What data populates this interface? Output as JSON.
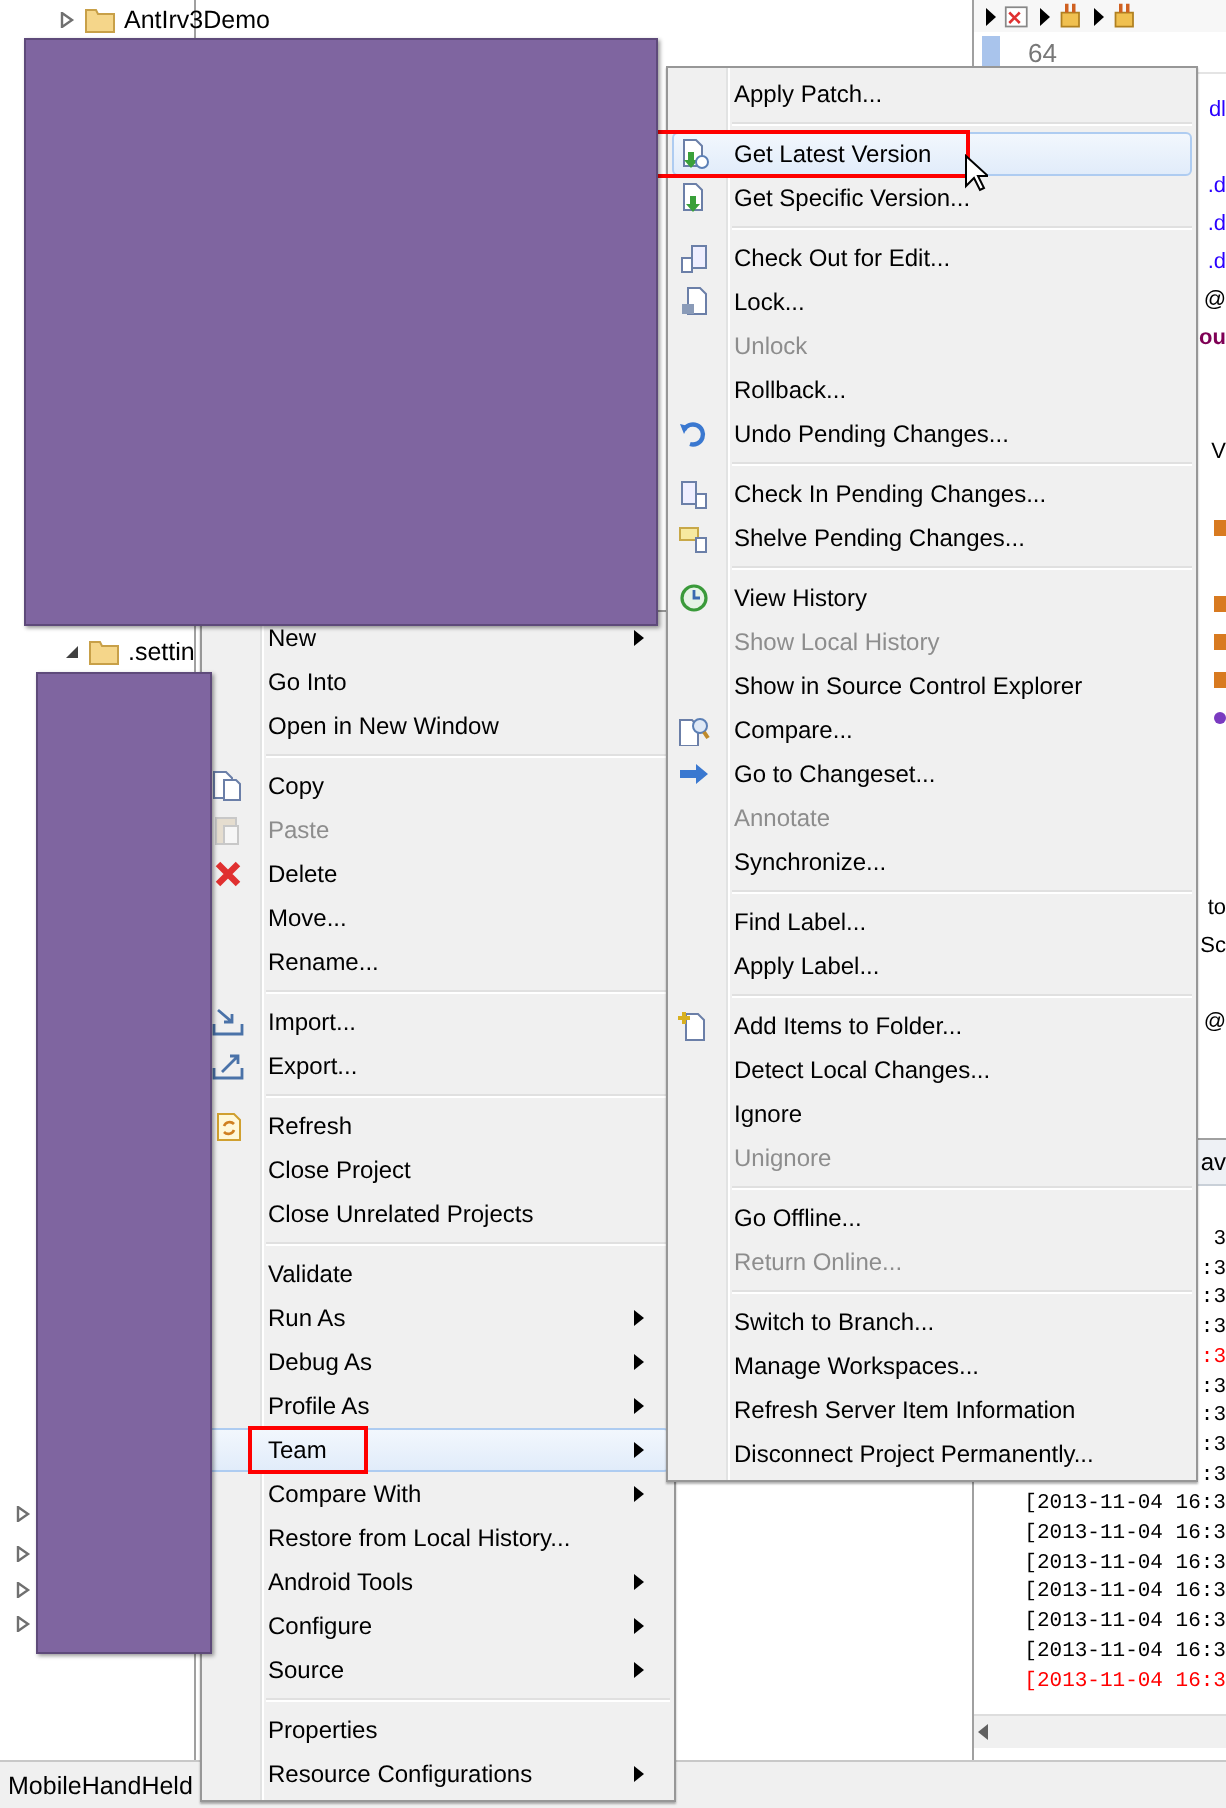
{
  "tree": [
    {
      "label": "AntIrv3Demo",
      "expanded": false
    },
    {
      "label": ".settin",
      "expanded": true
    },
    {
      "expanded": false
    },
    {
      "expanded": false
    },
    {
      "expanded": false
    },
    {
      "expanded": false
    }
  ],
  "editor": {
    "line_number": "64",
    "lines": [
      {
        "kind": "link",
        "text": "dl"
      },
      {
        "kind": "blank"
      },
      {
        "kind": "link",
        "text": ".d"
      },
      {
        "kind": "link",
        "text": ".d"
      },
      {
        "kind": "link",
        "text": ".d"
      },
      {
        "kind": "plain",
        "text": "@"
      },
      {
        "kind": "keyword",
        "text": "ou"
      },
      {
        "kind": "blank"
      },
      {
        "kind": "blank"
      },
      {
        "kind": "plain",
        "text": "V"
      },
      {
        "kind": "blank"
      },
      {
        "kind": "marker"
      },
      {
        "kind": "blank"
      },
      {
        "kind": "marker"
      },
      {
        "kind": "marker"
      },
      {
        "kind": "marker"
      },
      {
        "kind": "dot"
      },
      {
        "kind": "blank"
      },
      {
        "kind": "blank"
      },
      {
        "kind": "blank"
      },
      {
        "kind": "blank"
      },
      {
        "kind": "plain",
        "text": "to"
      },
      {
        "kind": "plain",
        "text": "Sc"
      },
      {
        "kind": "blank"
      },
      {
        "kind": "plain",
        "text": "@"
      }
    ]
  },
  "console": {
    "tab": "av",
    "lines": [
      {
        "text": "3",
        "error": false
      },
      {
        "text": ":3",
        "error": false
      },
      {
        "text": ":3",
        "error": false
      },
      {
        "text": ":3",
        "error": false
      },
      {
        "text": ":3",
        "error": true
      },
      {
        "text": ":3",
        "error": false
      },
      {
        "text": ":3",
        "error": false
      },
      {
        "text": ":3",
        "error": false
      },
      {
        "text": ":3",
        "error": false
      },
      {
        "text": "[2013-11-04 16:3",
        "error": false
      },
      {
        "text": "[2013-11-04 16:3",
        "error": false
      },
      {
        "text": "[2013-11-04 16:3",
        "error": false
      },
      {
        "text": "[2013-11-04 16:3",
        "error": false
      },
      {
        "text": "[2013-11-04 16:3",
        "error": false
      },
      {
        "text": "[2013-11-04 16:3",
        "error": false
      },
      {
        "text": "[2013-11-04 16:3",
        "error": true
      }
    ]
  },
  "status_bar": "MobileHandHeld",
  "redacted_areas": [
    {
      "kind": "block"
    },
    {
      "kind": "block"
    }
  ],
  "context_menu": {
    "groups": [
      [
        {
          "label": "New",
          "submenu": true,
          "disabled": false,
          "highlighted": false,
          "boxed": false
        },
        {
          "label": "Go Into",
          "submenu": false,
          "disabled": false,
          "highlighted": false,
          "boxed": false
        },
        {
          "label": "Open in New Window",
          "submenu": false,
          "disabled": false,
          "highlighted": false,
          "boxed": false
        }
      ],
      [
        {
          "label": "Copy",
          "submenu": false,
          "disabled": false,
          "highlighted": false,
          "boxed": false
        },
        {
          "label": "Paste",
          "submenu": false,
          "disabled": true,
          "highlighted": false,
          "boxed": false
        },
        {
          "label": "Delete",
          "submenu": false,
          "disabled": false,
          "highlighted": false,
          "boxed": false
        },
        {
          "label": "Move...",
          "submenu": false,
          "disabled": false,
          "highlighted": false,
          "boxed": false
        },
        {
          "label": "Rename...",
          "submenu": false,
          "disabled": false,
          "highlighted": false,
          "boxed": false
        }
      ],
      [
        {
          "label": "Import...",
          "submenu": false,
          "disabled": false,
          "highlighted": false,
          "boxed": false
        },
        {
          "label": "Export...",
          "submenu": false,
          "disabled": false,
          "highlighted": false,
          "boxed": false
        }
      ],
      [
        {
          "label": "Refresh",
          "submenu": false,
          "disabled": false,
          "highlighted": false,
          "boxed": false
        },
        {
          "label": "Close Project",
          "submenu": false,
          "disabled": false,
          "highlighted": false,
          "boxed": false
        },
        {
          "label": "Close Unrelated Projects",
          "submenu": false,
          "disabled": false,
          "highlighted": false,
          "boxed": false
        }
      ],
      [
        {
          "label": "Validate",
          "submenu": false,
          "disabled": false,
          "highlighted": false,
          "boxed": false
        },
        {
          "label": "Run As",
          "submenu": true,
          "disabled": false,
          "highlighted": false,
          "boxed": false
        },
        {
          "label": "Debug As",
          "submenu": true,
          "disabled": false,
          "highlighted": false,
          "boxed": false
        },
        {
          "label": "Profile As",
          "submenu": true,
          "disabled": false,
          "highlighted": false,
          "boxed": false
        },
        {
          "label": "Team",
          "submenu": true,
          "disabled": false,
          "highlighted": true,
          "boxed": true
        },
        {
          "label": "Compare With",
          "submenu": true,
          "disabled": false,
          "highlighted": false,
          "boxed": false
        },
        {
          "label": "Restore from Local History...",
          "submenu": false,
          "disabled": false,
          "highlighted": false,
          "boxed": false
        },
        {
          "label": "Android Tools",
          "submenu": true,
          "disabled": false,
          "highlighted": false,
          "boxed": false
        },
        {
          "label": "Configure",
          "submenu": true,
          "disabled": false,
          "highlighted": false,
          "boxed": false
        },
        {
          "label": "Source",
          "submenu": true,
          "disabled": false,
          "highlighted": false,
          "boxed": false
        }
      ],
      [
        {
          "label": "Properties",
          "submenu": false,
          "disabled": false,
          "highlighted": false,
          "boxed": false
        },
        {
          "label": "Resource Configurations",
          "submenu": true,
          "disabled": false,
          "highlighted": false,
          "boxed": false
        }
      ]
    ]
  },
  "team_submenu": {
    "groups": [
      [
        {
          "label": "Apply Patch...",
          "disabled": false,
          "highlighted": false,
          "boxed": false
        }
      ],
      [
        {
          "label": "Get Latest Version",
          "disabled": false,
          "highlighted": true,
          "boxed": true
        },
        {
          "label": "Get Specific Version...",
          "disabled": false,
          "highlighted": false,
          "boxed": false
        }
      ],
      [
        {
          "label": "Check Out for Edit...",
          "disabled": false,
          "highlighted": false,
          "boxed": false
        },
        {
          "label": "Lock...",
          "disabled": false,
          "highlighted": false,
          "boxed": false
        },
        {
          "label": "Unlock",
          "disabled": true,
          "highlighted": false,
          "boxed": false
        },
        {
          "label": "Rollback...",
          "disabled": false,
          "highlighted": false,
          "boxed": false
        },
        {
          "label": "Undo Pending Changes...",
          "disabled": false,
          "highlighted": false,
          "boxed": false
        }
      ],
      [
        {
          "label": "Check In Pending Changes...",
          "disabled": false,
          "highlighted": false,
          "boxed": false
        },
        {
          "label": "Shelve Pending Changes...",
          "disabled": false,
          "highlighted": false,
          "boxed": false
        }
      ],
      [
        {
          "label": "View History",
          "disabled": false,
          "highlighted": false,
          "boxed": false
        },
        {
          "label": "Show Local History",
          "disabled": true,
          "highlighted": false,
          "boxed": false
        },
        {
          "label": "Show in Source Control Explorer",
          "disabled": false,
          "highlighted": false,
          "boxed": false
        },
        {
          "label": "Compare...",
          "disabled": false,
          "highlighted": false,
          "boxed": false
        },
        {
          "label": "Go to Changeset...",
          "disabled": false,
          "highlighted": false,
          "boxed": false
        },
        {
          "label": "Annotate",
          "disabled": true,
          "highlighted": false,
          "boxed": false
        },
        {
          "label": "Synchronize...",
          "disabled": false,
          "highlighted": false,
          "boxed": false
        }
      ],
      [
        {
          "label": "Find Label...",
          "disabled": false,
          "highlighted": false,
          "boxed": false
        },
        {
          "label": "Apply Label...",
          "disabled": false,
          "highlighted": false,
          "boxed": false
        }
      ],
      [
        {
          "label": "Add Items to Folder...",
          "disabled": false,
          "highlighted": false,
          "boxed": false
        },
        {
          "label": "Detect Local Changes...",
          "disabled": false,
          "highlighted": false,
          "boxed": false
        },
        {
          "label": "Ignore",
          "disabled": false,
          "highlighted": false,
          "boxed": false
        },
        {
          "label": "Unignore",
          "disabled": true,
          "highlighted": false,
          "boxed": false
        }
      ],
      [
        {
          "label": "Go Offline...",
          "disabled": false,
          "highlighted": false,
          "boxed": false
        },
        {
          "label": "Return Online...",
          "disabled": true,
          "highlighted": false,
          "boxed": false
        }
      ],
      [
        {
          "label": "Switch to Branch...",
          "disabled": false,
          "highlighted": false,
          "boxed": false
        },
        {
          "label": "Manage Workspaces...",
          "disabled": false,
          "highlighted": false,
          "boxed": false
        },
        {
          "label": "Refresh Server Item Information",
          "disabled": false,
          "highlighted": false,
          "boxed": false
        },
        {
          "label": "Disconnect Project Permanently...",
          "disabled": false,
          "highlighted": false,
          "boxed": false
        }
      ]
    ]
  }
}
